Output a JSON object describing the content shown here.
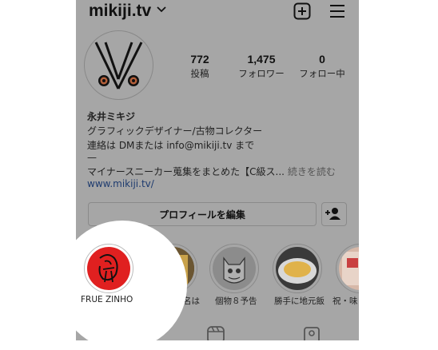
{
  "header": {
    "username": "mikiji.tv"
  },
  "stats": [
    {
      "value": "772",
      "label": "投稿"
    },
    {
      "value": "1,475",
      "label": "フォロワー"
    },
    {
      "value": "0",
      "label": "フォロー中"
    }
  ],
  "bio": {
    "name": "永井ミキジ",
    "line1": "グラフィックデザイナー/古物コレクター",
    "line2": "連絡は DMまたは info@mikiji.tv まで",
    "line3": "—",
    "line4": "マイナースニーカー蒐集をまとめた【C級ス...",
    "more": "続きを読む",
    "link": "www.mikiji.tv/"
  },
  "edit_profile_label": "プロフィールを編集",
  "highlights": [
    {
      "label": "FRUE ZINHO"
    },
    {
      "label": "その男の名は"
    },
    {
      "label": "個物８予告"
    },
    {
      "label": "勝手に地元飯"
    },
    {
      "label": "祝・味"
    }
  ],
  "tabs": [
    "grid-icon",
    "reels-icon",
    "tagged-icon"
  ],
  "colors": {
    "dim_overlay": "#a6a6a6",
    "spotlight": "#ffffff",
    "link": "#1e3b6f",
    "highlight_red": "#e02020"
  }
}
